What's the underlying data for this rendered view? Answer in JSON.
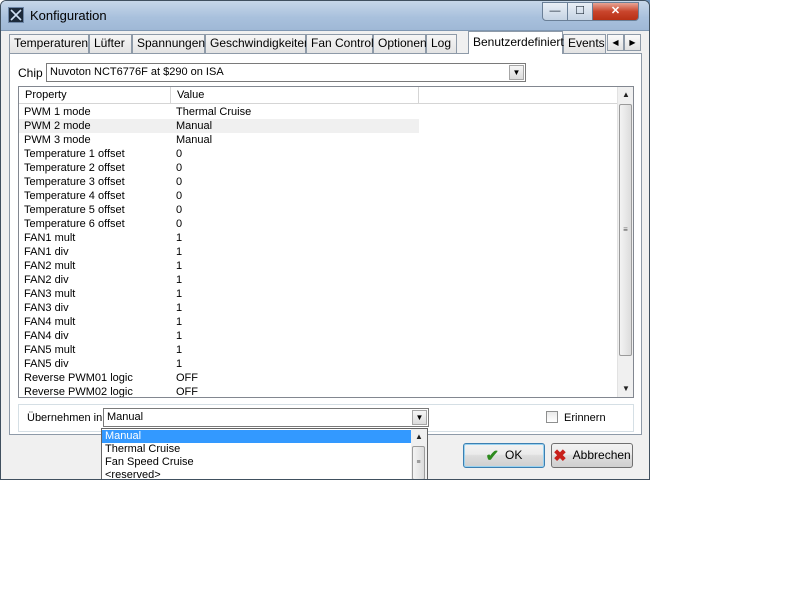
{
  "window": {
    "title": "Konfiguration",
    "minimize_glyph": "—",
    "maximize_glyph": "☐",
    "close_glyph": "✕"
  },
  "tabs": [
    {
      "label": "Temperaturen"
    },
    {
      "label": "Lüfter"
    },
    {
      "label": "Spannungen"
    },
    {
      "label": "Geschwindigkeiten"
    },
    {
      "label": "Fan Control"
    },
    {
      "label": "Optionen"
    },
    {
      "label": "Log"
    },
    {
      "label": "Benutzerdefiniert"
    },
    {
      "label": "Events"
    }
  ],
  "tab_scroll": {
    "left_glyph": "◀",
    "right_glyph": "▶"
  },
  "chip": {
    "label": "Chip",
    "value": "Nuvoton NCT6776F at $290 on ISA",
    "arrow": "▼"
  },
  "grid": {
    "columns": {
      "property": "Property",
      "value": "Value"
    },
    "rows": [
      {
        "property": "PWM 1 mode",
        "value": "Thermal Cruise"
      },
      {
        "property": "PWM 2 mode",
        "value": "Manual"
      },
      {
        "property": "PWM 3 mode",
        "value": "Manual"
      },
      {
        "property": "Temperature 1 offset",
        "value": "0"
      },
      {
        "property": "Temperature 2 offset",
        "value": "0"
      },
      {
        "property": "Temperature 3 offset",
        "value": "0"
      },
      {
        "property": "Temperature 4 offset",
        "value": "0"
      },
      {
        "property": "Temperature 5 offset",
        "value": "0"
      },
      {
        "property": "Temperature 6 offset",
        "value": "0"
      },
      {
        "property": "FAN1 mult",
        "value": "1"
      },
      {
        "property": "FAN1 div",
        "value": "1"
      },
      {
        "property": "FAN2 mult",
        "value": "1"
      },
      {
        "property": "FAN2 div",
        "value": "1"
      },
      {
        "property": "FAN3 mult",
        "value": "1"
      },
      {
        "property": "FAN3 div",
        "value": "1"
      },
      {
        "property": "FAN4 mult",
        "value": "1"
      },
      {
        "property": "FAN4 div",
        "value": "1"
      },
      {
        "property": "FAN5 mult",
        "value": "1"
      },
      {
        "property": "FAN5 div",
        "value": "1"
      },
      {
        "property": "Reverse PWM01 logic",
        "value": "OFF"
      },
      {
        "property": "Reverse PWM02 logic",
        "value": "OFF"
      }
    ],
    "selected_row": 1,
    "scroll_up_glyph": "▲",
    "scroll_down_glyph": "▼",
    "thumb_grip": "≡"
  },
  "apply": {
    "label": "Übernehmen in",
    "value": "Manual",
    "arrow": "▼",
    "remember_label": "Erinnern",
    "remember_checked": false
  },
  "dropdown": {
    "options": [
      "Manual",
      "Thermal Cruise",
      "Fan Speed Cruise",
      "<reserved>"
    ],
    "highlighted": 0,
    "scroll_up_glyph": "▲",
    "thumb_grip": "≡"
  },
  "buttons": {
    "ok_label": "OK",
    "ok_icon": "✔",
    "cancel_label": "Abbrechen",
    "cancel_icon": "✖"
  },
  "colors": {
    "selection": "#3399ff",
    "ok_icon": "#2d8a1e",
    "cancel_icon": "#c8201b"
  }
}
